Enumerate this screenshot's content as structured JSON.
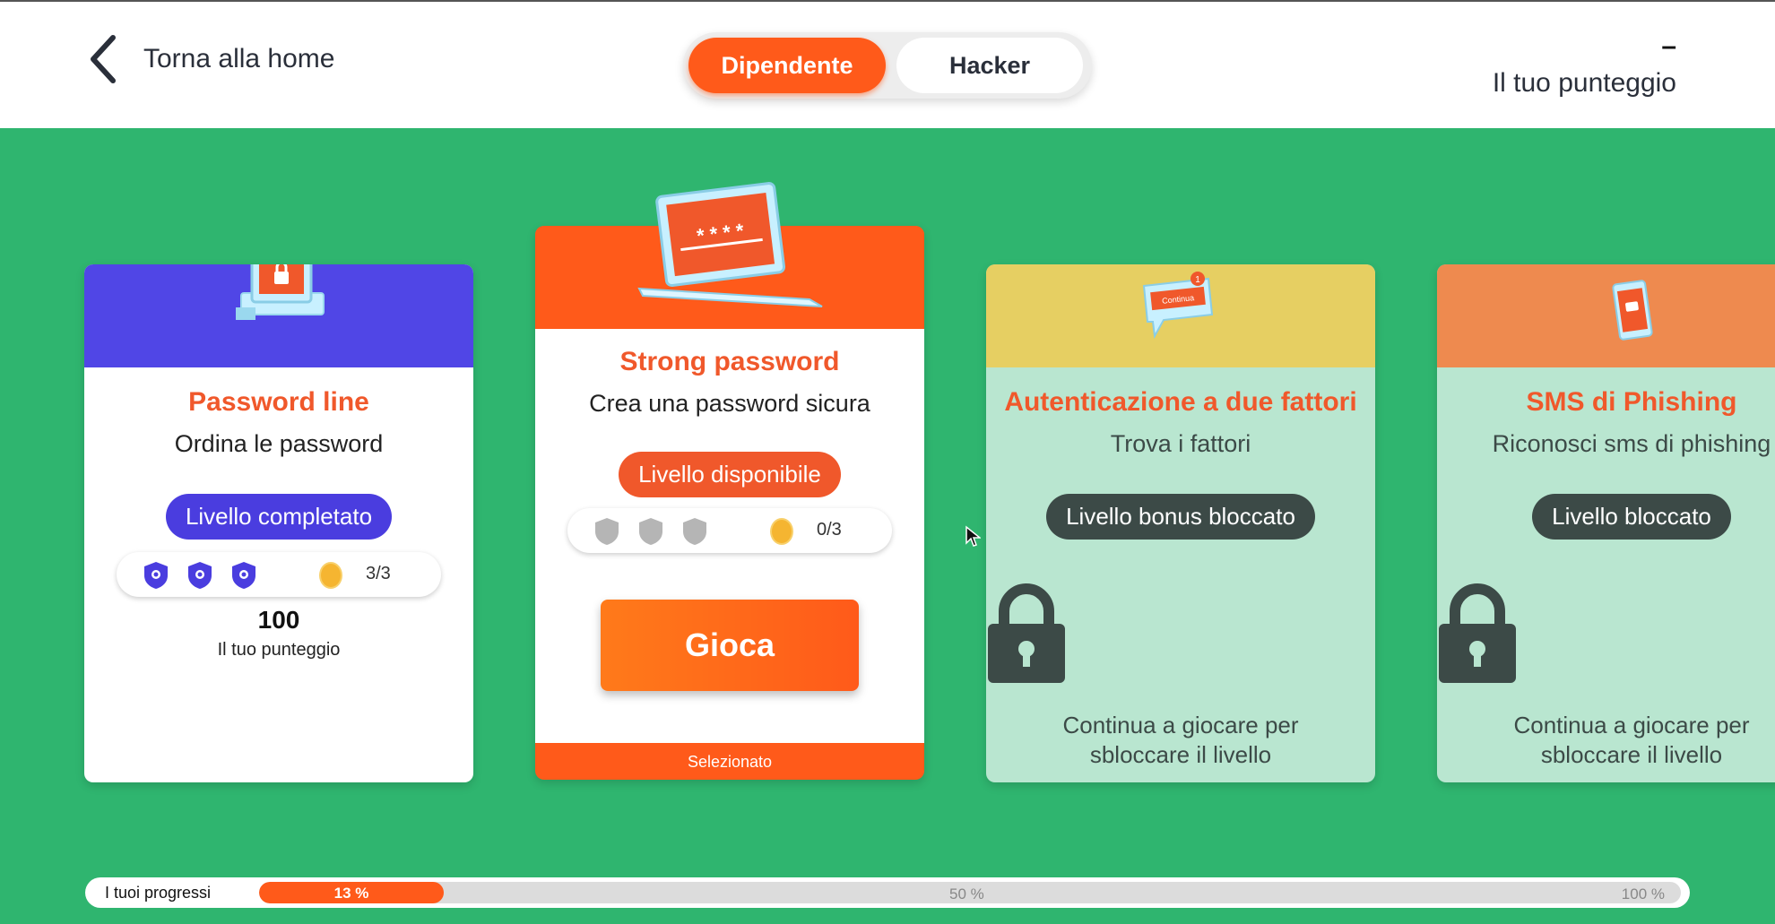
{
  "header": {
    "back_label": "Torna alla home",
    "toggle": {
      "active": "Dipendente",
      "inactive": "Hacker"
    },
    "score_value": "–",
    "score_label": "Il tuo punteggio"
  },
  "cards": [
    {
      "title": "Password line",
      "subtitle": "Ordina le password",
      "status": "Livello completato",
      "shields": "3/3",
      "score_value": "100",
      "score_label": "Il tuo punteggio",
      "head_color": "#5046e6",
      "body_color": "#ffffff",
      "pill_color": "#4a3ddf",
      "icon": "locked-computer-icon"
    },
    {
      "title": "Strong password",
      "subtitle": "Crea una password sicura",
      "status": "Livello disponibile",
      "shields": "0/3",
      "button": "Gioca",
      "footer": "Selezionato",
      "head_color": "#ff5a1a",
      "body_color": "#ffffff",
      "pill_color": "#f0582b",
      "icon": "password-laptop-icon",
      "screen_text": "* * * *"
    },
    {
      "title": "Autenticazione a due fattori",
      "subtitle": "Trova i fattori",
      "status": "Livello bonus bloccato",
      "lock_text": "Continua a giocare per sbloccare il livello",
      "head_color": "#e6cf62",
      "body_color": "#b9e6d0",
      "pill_color": "#3c4a47",
      "icon": "chat-bubble-icon",
      "badge_text": "1",
      "bubble_text": "Continua"
    },
    {
      "title": "SMS di Phishing",
      "subtitle": "Riconosci sms di phishing",
      "status": "Livello bloccato",
      "lock_text": "Continua a giocare per sbloccare il livello",
      "head_color": "#ee8a4f",
      "body_color": "#b9e6d0",
      "pill_color": "#3c4a47",
      "icon": "phone-sms-icon"
    }
  ],
  "progress": {
    "label": "I tuoi progressi",
    "value_label": "13 %",
    "value": 0.13,
    "mark_mid": "50 %",
    "mark_end": "100 %"
  }
}
